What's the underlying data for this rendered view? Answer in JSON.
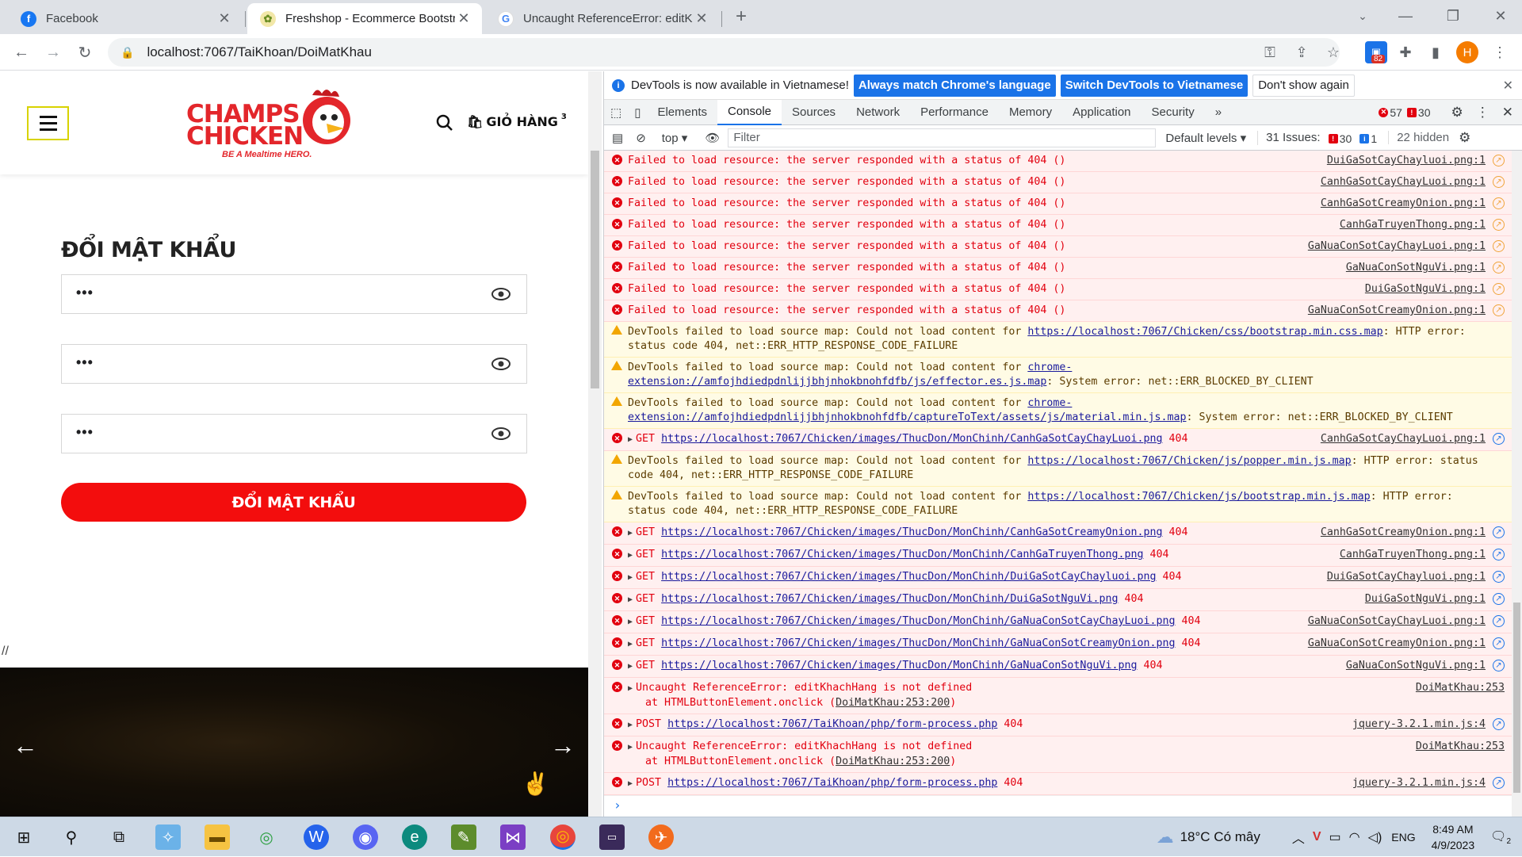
{
  "tabs": [
    {
      "title": "Facebook",
      "icon": "facebook-icon"
    },
    {
      "title": "Freshshop - Ecommerce Bootstra",
      "icon": "freshshop-icon"
    },
    {
      "title": "Uncaught ReferenceError: editKh",
      "icon": "google-icon"
    }
  ],
  "toolbar": {
    "url": "localhost:7067/TaiKhoan/DoiMatKhau",
    "ext_badge": "82",
    "profile_initial": "H"
  },
  "site": {
    "logo_line1": "CHAMPS",
    "logo_line2": "CHICKEN",
    "logo_tagline": "BE A Mealtime HERO.",
    "cart_label": "GIỎ HÀNG",
    "cart_count": "3",
    "form_title": "ĐỔI MẬT KHẨU",
    "password_values": [
      "•••",
      "•••",
      "•••"
    ],
    "submit_label": "ĐỔI MẬT KHẨU",
    "slashes": "//"
  },
  "devtools": {
    "banner_text": "DevTools is now available in Vietnamese!",
    "banner_btn1": "Always match Chrome's language",
    "banner_btn2": "Switch DevTools to Vietnamese",
    "banner_btn3": "Don't show again",
    "tabs": [
      "Elements",
      "Console",
      "Sources",
      "Network",
      "Performance",
      "Memory",
      "Application",
      "Security"
    ],
    "active_tab": "Console",
    "error_count": "57",
    "warning_count": "30",
    "context": "top",
    "filter_placeholder": "Filter",
    "levels": "Default levels",
    "issues_label": "31 Issues:",
    "issues_err": "30",
    "issues_info": "1",
    "hidden": "22 hidden",
    "prompt": "›"
  },
  "console": [
    {
      "type": "err",
      "light": true,
      "msg": "Failed to load resource: the server responded with a status of 404 ()",
      "src": "DuiGaSotCayChayluoi.png:1"
    },
    {
      "type": "err",
      "light": true,
      "msg": "Failed to load resource: the server responded with a status of 404 ()",
      "src": "CanhGaSotCayChayLuoi.png:1"
    },
    {
      "type": "err",
      "light": true,
      "msg": "Failed to load resource: the server responded with a status of 404 ()",
      "src": "CanhGaSotCreamyOnion.png:1"
    },
    {
      "type": "err",
      "light": true,
      "msg": "Failed to load resource: the server responded with a status of 404 ()",
      "src": "CanhGaTruyenThong.png:1"
    },
    {
      "type": "err",
      "light": true,
      "msg": "Failed to load resource: the server responded with a status of 404 ()",
      "src": "GaNuaConSotCayChayLuoi.png:1"
    },
    {
      "type": "err",
      "light": true,
      "msg": "Failed to load resource: the server responded with a status of 404 ()",
      "src": "GaNuaConSotNguVi.png:1"
    },
    {
      "type": "err",
      "light": true,
      "msg": "Failed to load resource: the server responded with a status of 404 ()",
      "src": "DuiGaSotNguVi.png:1"
    },
    {
      "type": "err",
      "light": true,
      "msg": "Failed to load resource: the server responded with a status of 404 ()",
      "src": "GaNuaConSotCreamyOnion.png:1"
    },
    {
      "type": "warn",
      "msg": "DevTools failed to load source map: Could not load content for ",
      "link": "https://localhost:7067/Chicken/css/bootstrap.min.css.map",
      "after": ": HTTP error: status code 404, net::ERR_HTTP_RESPONSE_CODE_FAILURE"
    },
    {
      "type": "warn",
      "msg": "DevTools failed to load source map: Could not load content for ",
      "link": "chrome-extension://amfojhdiedpdnlijjbhjnhokbnohfdfb/js/effector.es.js.map",
      "after": ": System error: net::ERR_BLOCKED_BY_CLIENT"
    },
    {
      "type": "warn",
      "msg": "DevTools failed to load source map: Could not load content for ",
      "link": "chrome-extension://amfojhdiedpdnlijjbhjnhokbnohfdfb/captureToText/assets/js/material.min.js.map",
      "after": ": System error: net::ERR_BLOCKED_BY_CLIENT"
    },
    {
      "type": "err",
      "get": "GET",
      "link": "https://localhost:7067/Chicken/images/ThucDon/MonChinh/CanhGaSotCayChayLuoi.png",
      "after": " 404",
      "src": "CanhGaSotCayChayLuoi.png:1"
    },
    {
      "type": "warn",
      "msg": "DevTools failed to load source map: Could not load content for ",
      "link": "https://localhost:7067/Chicken/js/popper.min.js.map",
      "after": ": HTTP error: status code 404, net::ERR_HTTP_RESPONSE_CODE_FAILURE"
    },
    {
      "type": "warn",
      "msg": "DevTools failed to load source map: Could not load content for ",
      "link": "https://localhost:7067/Chicken/js/bootstrap.min.js.map",
      "after": ": HTTP error: status code 404, net::ERR_HTTP_RESPONSE_CODE_FAILURE"
    },
    {
      "type": "err",
      "get": "GET",
      "link": "https://localhost:7067/Chicken/images/ThucDon/MonChinh/CanhGaSotCreamyOnion.png",
      "after": " 404",
      "src": "CanhGaSotCreamyOnion.png:1"
    },
    {
      "type": "err",
      "get": "GET",
      "link": "https://localhost:7067/Chicken/images/ThucDon/MonChinh/CanhGaTruyenThong.png",
      "after": " 404",
      "src": "CanhGaTruyenThong.png:1"
    },
    {
      "type": "err",
      "get": "GET",
      "link": "https://localhost:7067/Chicken/images/ThucDon/MonChinh/DuiGaSotCayChayluoi.png",
      "after": " 404",
      "src": "DuiGaSotCayChayluoi.png:1"
    },
    {
      "type": "err",
      "get": "GET",
      "link": "https://localhost:7067/Chicken/images/ThucDon/MonChinh/DuiGaSotNguVi.png",
      "after": " 404",
      "src": "DuiGaSotNguVi.png:1"
    },
    {
      "type": "err",
      "get": "GET",
      "link": "https://localhost:7067/Chicken/images/ThucDon/MonChinh/GaNuaConSotCayChayLuoi.png",
      "after": " 404",
      "src": "GaNuaConSotCayChayLuoi.png:1"
    },
    {
      "type": "err",
      "get": "GET",
      "link": "https://localhost:7067/Chicken/images/ThucDon/MonChinh/GaNuaConSotCreamyOnion.png",
      "after": " 404",
      "src": "GaNuaConSotCreamyOnion.png:1"
    },
    {
      "type": "err",
      "get": "GET",
      "link": "https://localhost:7067/Chicken/images/ThucDon/MonChinh/GaNuaConSotNguVi.png",
      "after": " 404",
      "src": "GaNuaConSotNguVi.png:1"
    },
    {
      "type": "err",
      "ref": true,
      "msg": "Uncaught ReferenceError: editKhachHang is not defined",
      "sub_pre": "at HTMLButtonElement.onclick (",
      "sub_link": "DoiMatKhau:253:200",
      "sub_post": ")",
      "src": "DoiMatKhau:253",
      "nogo": true
    },
    {
      "type": "err",
      "get": "POST",
      "link": "https://localhost:7067/TaiKhoan/php/form-process.php",
      "after": " 404",
      "src": "jquery-3.2.1.min.js:4"
    },
    {
      "type": "err",
      "ref": true,
      "msg": "Uncaught ReferenceError: editKhachHang is not defined",
      "sub_pre": "at HTMLButtonElement.onclick (",
      "sub_link": "DoiMatKhau:253:200",
      "sub_post": ")",
      "src": "DoiMatKhau:253",
      "nogo": true
    },
    {
      "type": "err",
      "get": "POST",
      "link": "https://localhost:7067/TaiKhoan/php/form-process.php",
      "after": " 404",
      "src": "jquery-3.2.1.min.js:4"
    }
  ],
  "taskbar": {
    "weather": "18°C Có mây",
    "lang": "ENG",
    "time": "8:49 AM",
    "date": "4/9/2023",
    "notif": "2"
  },
  "colors": {
    "brand_red": "#e3262b",
    "button_red": "#f30d0d",
    "accent_blue": "#1a73e8"
  }
}
